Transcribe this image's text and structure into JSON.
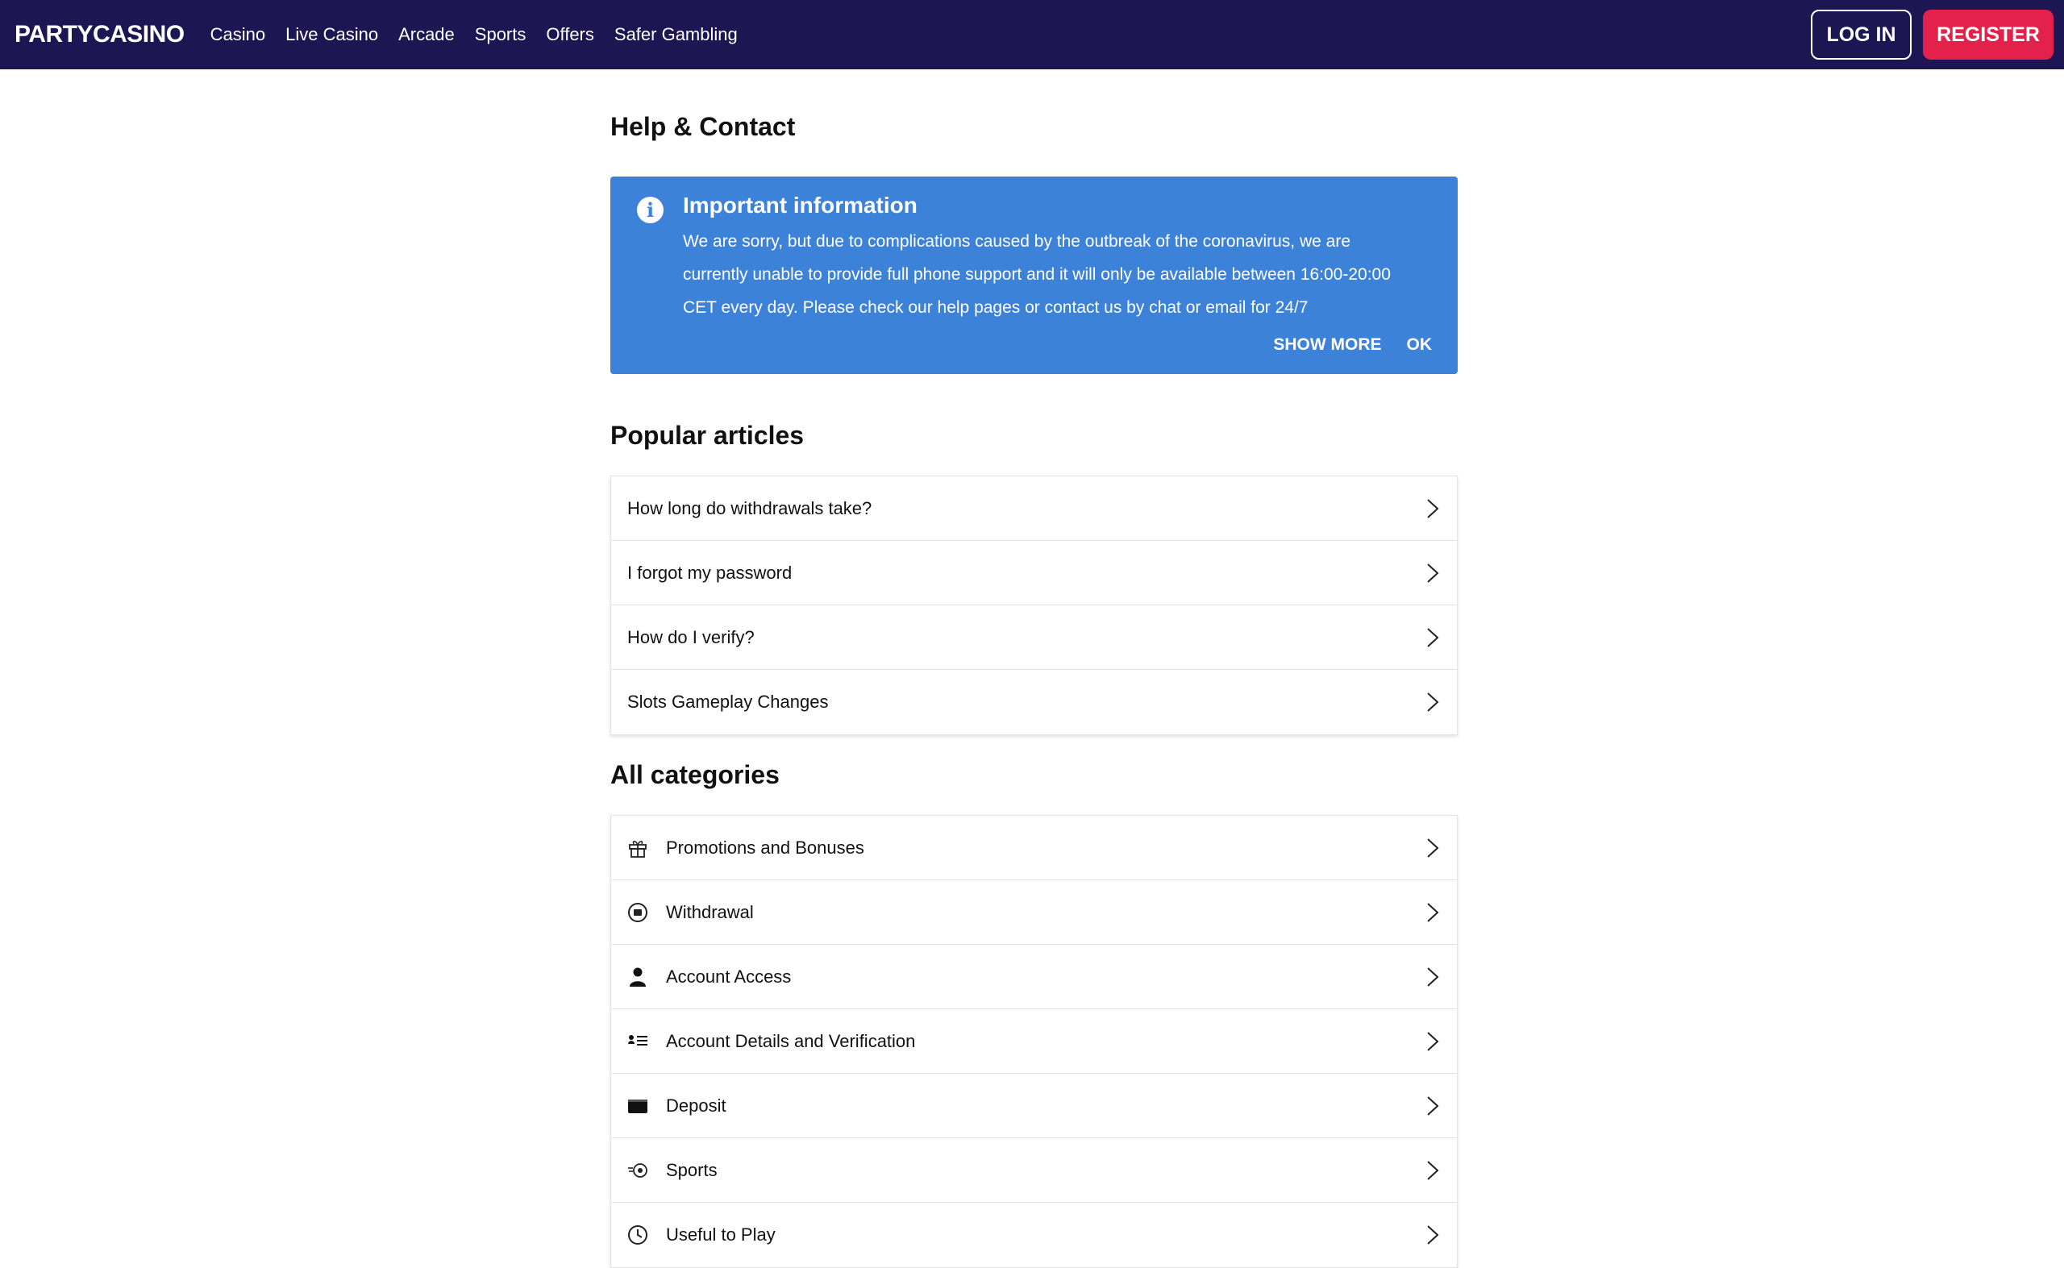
{
  "header": {
    "logo": "PARTYCASINO",
    "nav": [
      {
        "label": "Casino"
      },
      {
        "label": "Live Casino"
      },
      {
        "label": "Arcade"
      },
      {
        "label": "Sports"
      },
      {
        "label": "Offers"
      },
      {
        "label": "Safer Gambling"
      }
    ],
    "login_label": "LOG IN",
    "register_label": "REGISTER"
  },
  "page": {
    "title": "Help & Contact"
  },
  "notice": {
    "icon": "info-icon",
    "title": "Important information",
    "text": "We are sorry, but due to complications caused by the outbreak of the coronavirus, we are currently unable to provide full phone support and it will only be available between 16:00-20:00 CET every day. Please check our help pages or contact us by chat or email for 24/7",
    "show_more": "SHOW MORE",
    "ok": "OK"
  },
  "popular": {
    "title": "Popular articles",
    "items": [
      {
        "label": "How long do withdrawals take?"
      },
      {
        "label": "I forgot my password"
      },
      {
        "label": "How do I verify?"
      },
      {
        "label": "Slots Gameplay Changes"
      }
    ]
  },
  "categories": {
    "title": "All categories",
    "items": [
      {
        "label": "Promotions and Bonuses",
        "icon": "gift-icon"
      },
      {
        "label": "Withdrawal",
        "icon": "withdrawal-icon"
      },
      {
        "label": "Account Access",
        "icon": "person-icon"
      },
      {
        "label": "Account Details and Verification",
        "icon": "id-list-icon"
      },
      {
        "label": "Deposit",
        "icon": "wallet-icon"
      },
      {
        "label": "Sports",
        "icon": "sports-ball-icon"
      },
      {
        "label": "Useful to Play",
        "icon": "clock-icon"
      }
    ]
  },
  "colors": {
    "header_bg": "#1c1752",
    "register_bg": "#e3214a",
    "notice_bg": "#3d82d9"
  }
}
